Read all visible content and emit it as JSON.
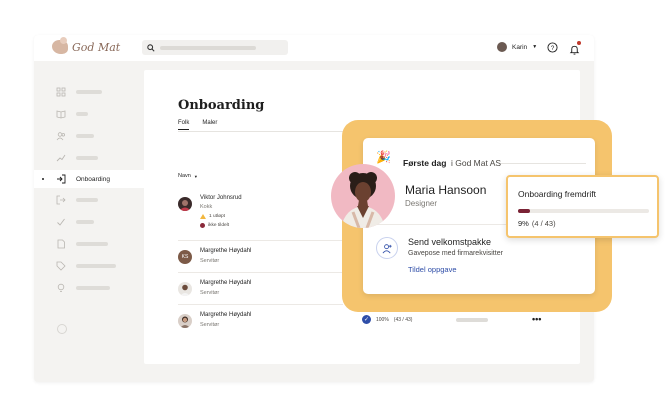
{
  "app": {
    "brand": "God Mat"
  },
  "topbar": {
    "user_name": "Karin"
  },
  "sidebar": {
    "active_label": "Onboarding"
  },
  "page": {
    "title": "Onboarding",
    "tabs": [
      {
        "label": "Folk"
      },
      {
        "label": "Maler"
      }
    ],
    "column_header": "Navn"
  },
  "people": [
    {
      "name": "Viktor Johnsrud",
      "role": "Kokk",
      "meta1": "1 utløpt",
      "meta2": "ikke tildelt"
    },
    {
      "name": "Margrethe Høydahl",
      "role": "Servitør",
      "initials": "KS"
    },
    {
      "name": "Margrethe Høydahl",
      "role": "Servitør"
    },
    {
      "name": "Margrethe Høydahl",
      "role": "Servitør"
    }
  ],
  "bottom_row": {
    "progress_text": "100%",
    "progress_count": "(43 / 43)"
  },
  "card": {
    "day_title": "Første dag",
    "company": "i God Mat AS",
    "hero_name": "Maria Hansoon",
    "hero_role": "Designer",
    "task_title": "Send velkomstpakke",
    "task_sub": "Gavepose med firmarekvisitter",
    "task_link": "Tildel oppgave"
  },
  "progress_popup": {
    "title": "Onboarding fremdrift",
    "percent_text": "9%",
    "count_text": "(4 / 43)",
    "fraction": 0.09
  },
  "colors": {
    "accent_yellow": "#f5c46d",
    "link_blue": "#2f4ea8",
    "progress_fill": "#7a2235"
  }
}
